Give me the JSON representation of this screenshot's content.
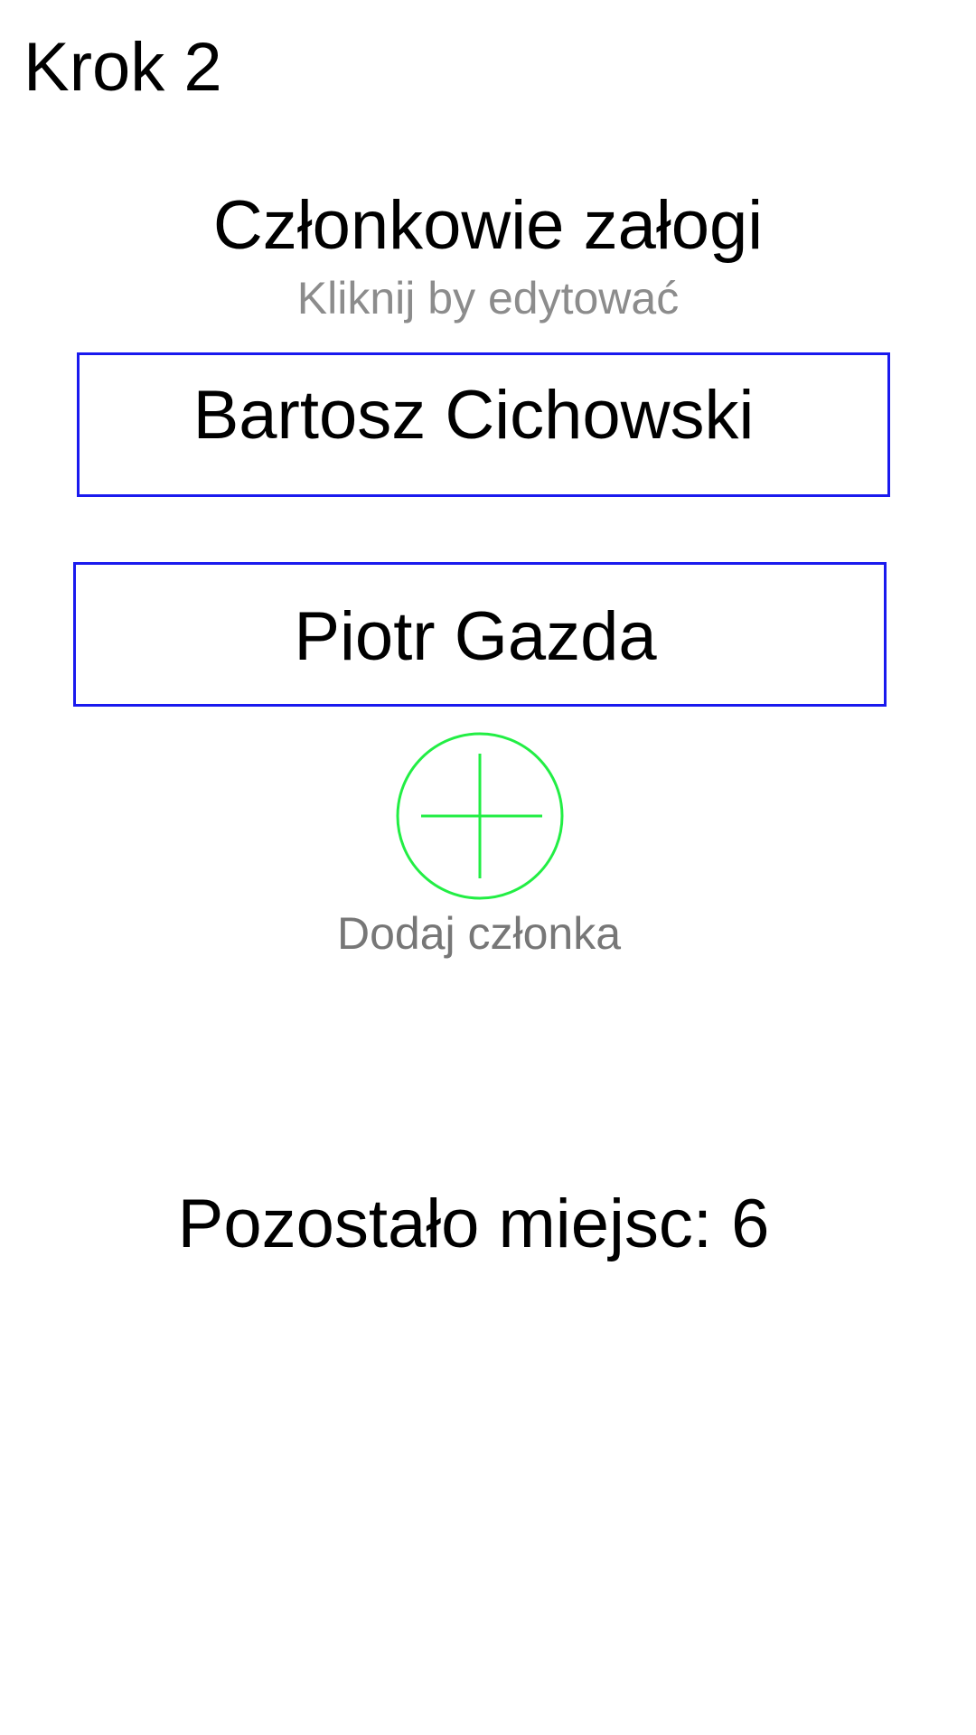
{
  "header": {
    "step_label": "Krok 2"
  },
  "crew": {
    "title": "Członkowie załogi",
    "hint": "Kliknij by edytować",
    "members": [
      {
        "name": "Bartosz Cichowski"
      },
      {
        "name": "Piotr Gazda"
      }
    ],
    "add_label": "Dodaj członka",
    "add_icon": "plus-circle-icon",
    "remaining_text": "Pozostało miejsc: 6"
  },
  "colors": {
    "member_border": "#1a1aee",
    "add_icon": "#22ee44",
    "hint_text": "#8c8c8c",
    "add_label_text": "#777777"
  }
}
